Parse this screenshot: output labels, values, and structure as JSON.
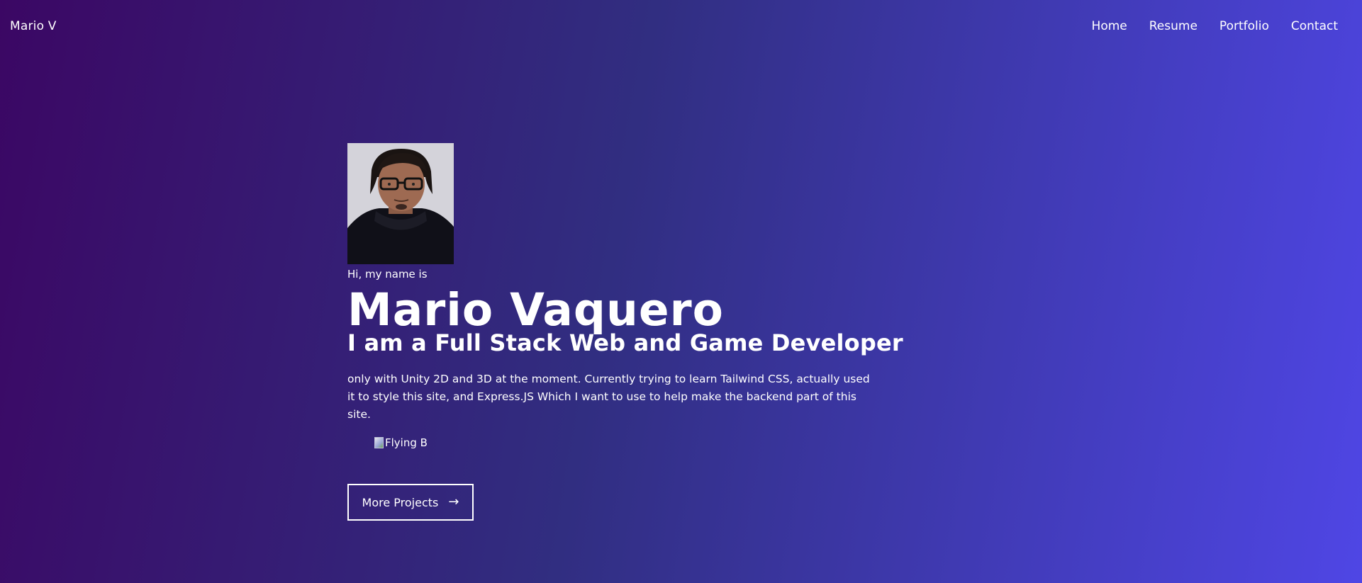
{
  "nav": {
    "brand": "Mario V",
    "links": [
      {
        "label": "Home"
      },
      {
        "label": "Resume"
      },
      {
        "label": "Portfolio"
      },
      {
        "label": "Contact"
      }
    ]
  },
  "hero": {
    "intro": "Hi, my name is",
    "name": "Mario Vaquero",
    "headline": "I am a Full Stack Web and Game Developer",
    "description": "only with Unity 2D and 3D at the moment. Currently trying to learn Tailwind CSS, actually used it to style this site, and Express.JS Which I want to use to help make the backend part of this site.",
    "image_alt": "Flying B",
    "button_label": "More Projects",
    "button_icon": "arrow-right-icon"
  },
  "colors": {
    "gradient_start": "#3b0764",
    "gradient_mid": "#312e81",
    "gradient_end": "#4f46e5",
    "text": "#ffffff"
  }
}
